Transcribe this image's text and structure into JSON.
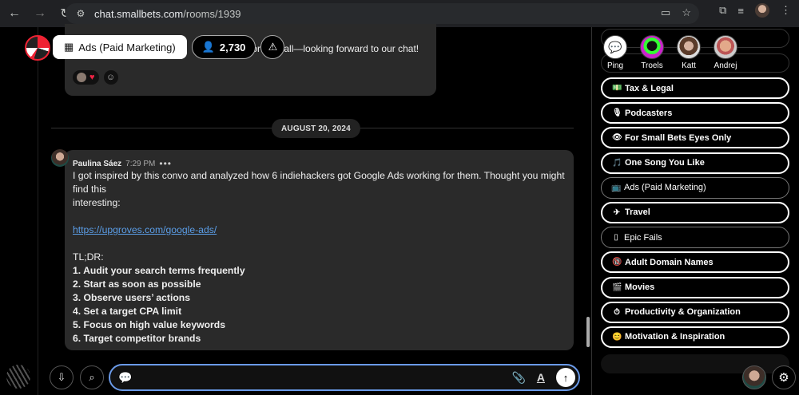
{
  "browser": {
    "url_host": "chat.smallbets.com",
    "url_path": "/rooms/1939"
  },
  "room_header": {
    "room_name": "Ads (Paid Marketing)",
    "member_count": "2,730"
  },
  "previous_message": {
    "text_fragment": "nk for the call—looking forward to our chat!"
  },
  "date_separator": "AUGUST 20, 2024",
  "message": {
    "author": "Paulina Sáez",
    "time": "7:29 PM",
    "more": "•••",
    "lines": {
      "intro1": "I got inspired by this convo and analyzed how 6 indiehackers got Google Ads working for them. Thought you might find this",
      "intro2": "interesting:",
      "link": "https://upgroves.com/google-ads/",
      "tldr": "TL;DR:",
      "p1": "1. Audit your search terms frequently",
      "p2": "2. Start as soon as possible",
      "p3": "3. Observe users’ actions",
      "p4": "4. Set a target CPA limit",
      "p5": "5. Focus on high value keywords",
      "p6": "6. Target competitor brands"
    }
  },
  "composer": {
    "placeholder": ""
  },
  "sidebar": {
    "people": [
      {
        "name": "Ping"
      },
      {
        "name": "Troels"
      },
      {
        "name": "Katt"
      },
      {
        "name": "Andrej"
      }
    ],
    "rooms": [
      {
        "icon": "💵",
        "label": "Tax & Legal"
      },
      {
        "icon": "🎙",
        "label": "Podcasters"
      },
      {
        "icon": "👁",
        "label": "For Small Bets Eyes Only"
      },
      {
        "icon": "🎵",
        "label": "One Song You Like"
      },
      {
        "icon": "📺",
        "label": "Ads (Paid Marketing)"
      },
      {
        "icon": "✈",
        "label": "Travel"
      },
      {
        "icon": "▯",
        "label": "Epic Fails"
      },
      {
        "icon": "🔞",
        "label": "Adult Domain Names"
      },
      {
        "icon": "🎬",
        "label": "Movies"
      },
      {
        "icon": "⏱",
        "label": "Productivity & Organization"
      },
      {
        "icon": "😊",
        "label": "Motivation & Inspiration"
      }
    ]
  }
}
